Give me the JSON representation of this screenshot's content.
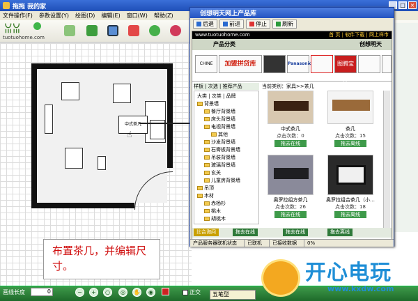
{
  "app": {
    "title": "拖拖 我的家",
    "menu": [
      "文件操作(F)",
      "参数设置(Y)",
      "绘图(D)",
      "编辑(E)",
      "窗口(W)",
      "帮助(Z)"
    ],
    "logo_site": "tuotuohome.com"
  },
  "canvas": {
    "tea_table_label": "中式茶几",
    "note": "布置茶几，并编辑尺寸。"
  },
  "bottombar": {
    "length_label": "画线长度",
    "length_value": "0",
    "ortho_label": "正交",
    "ime_label": "五笔型"
  },
  "popup": {
    "title": "创想明天网上产品库",
    "toolbar": {
      "back": "后退",
      "forward": "前进",
      "stop": "停止",
      "refresh": "刷新"
    },
    "site": "www.tuotuohome.com",
    "head_links": "首 页 | 软件下载 | 网上样市",
    "cat_left": "产品分类",
    "cat_right": "创想明天",
    "banners": [
      "CHINE",
      "加盟拼贷库",
      "",
      "Panasonic",
      "",
      "图腾宝库",
      "",
      ""
    ],
    "tabs": "样板 | 次选 | 推荐产品",
    "crumb": "当前类别：家具>>茶几",
    "tree_header": "大类 | 次类 | 品牌",
    "tree": [
      "背景墙",
      "餐厅背景墙",
      "床头背景墙",
      "电视背景墙",
      "其他",
      "沙发背景墙",
      "石膏板背景墙",
      "吊装背景墙",
      "玻璃背景墙",
      "玄关",
      "儿童房背景墙",
      "吊顶",
      "木材",
      "赤杨杉",
      "桃木",
      "胡桃木"
    ],
    "products": [
      {
        "name": "中式茶几",
        "views": "点击次数：0",
        "action": "拖去在线"
      },
      {
        "name": "茶几",
        "views": "点击次数：15",
        "action": "拖去离线"
      },
      {
        "name": "奥罗拉组方茶几",
        "views": "点击次数：26",
        "action": "拖去在线"
      },
      {
        "name": "奥罗拉组合茶几（小…",
        "views": "点击次数：18",
        "action": "拖去离线"
      }
    ],
    "foot_buttons": [
      "比合询问",
      "拖去在线",
      "拖去在线",
      "拖去离线"
    ],
    "status": [
      "产品服务器联机状态",
      "已联机",
      "已接收数据",
      "0%"
    ]
  },
  "watermark": {
    "title": "开心电玩",
    "url": "www.kxdw.com"
  },
  "colors": {
    "titlebar": "#2453c0",
    "bottombar": "#2a7a34",
    "note_text": "#d01010",
    "watermark": "#1e8ed6"
  }
}
